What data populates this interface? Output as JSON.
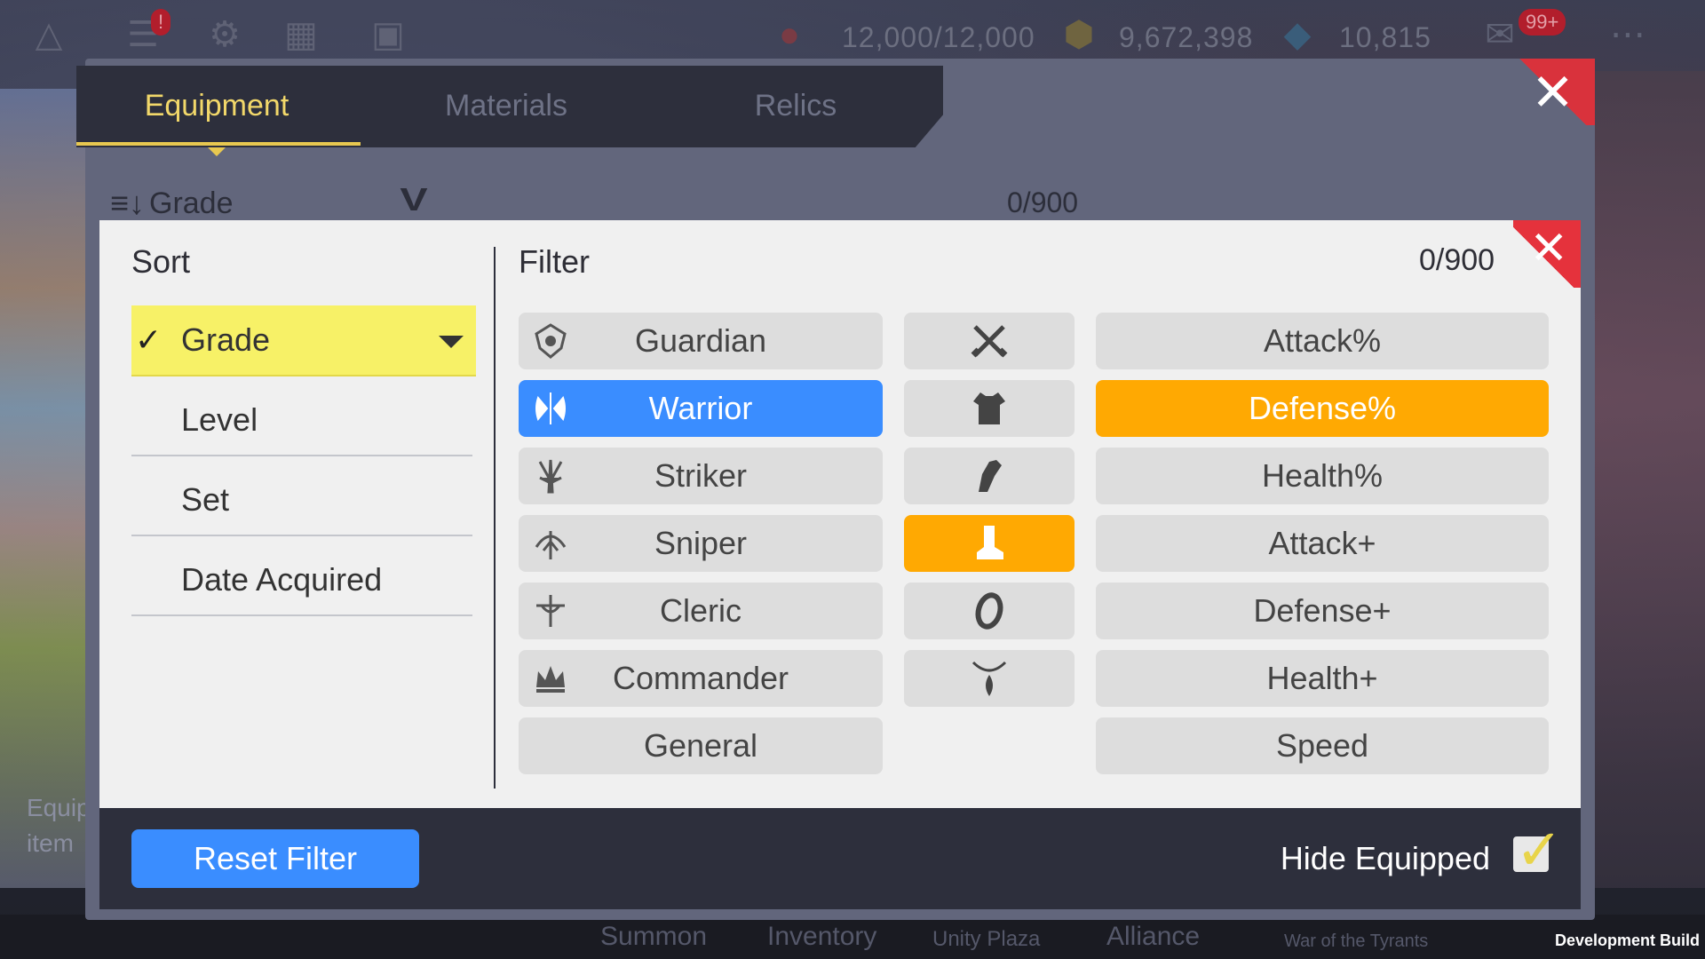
{
  "hud": {
    "stamina": "12,000/12,000",
    "gold": "9,672,398",
    "gems": "10,815",
    "mail_badge": "99+",
    "alert_badge": "!"
  },
  "panel": {
    "tabs": [
      {
        "label": "Equipment",
        "active": true
      },
      {
        "label": "Materials",
        "active": false
      },
      {
        "label": "Relics",
        "active": false
      }
    ],
    "sort_label": "Grade",
    "count": "0/900"
  },
  "modal": {
    "sort_title": "Sort",
    "filter_title": "Filter",
    "count": "0/900",
    "sort_options": [
      {
        "label": "Grade",
        "selected": true
      },
      {
        "label": "Level",
        "selected": false
      },
      {
        "label": "Set",
        "selected": false
      },
      {
        "label": "Date Acquired",
        "selected": false
      }
    ],
    "classes": [
      {
        "label": "Guardian",
        "icon": "guardian-icon",
        "selected": false
      },
      {
        "label": "Warrior",
        "icon": "warrior-icon",
        "selected": true
      },
      {
        "label": "Striker",
        "icon": "striker-icon",
        "selected": false
      },
      {
        "label": "Sniper",
        "icon": "sniper-icon",
        "selected": false
      },
      {
        "label": "Cleric",
        "icon": "cleric-icon",
        "selected": false
      },
      {
        "label": "Commander",
        "icon": "commander-icon",
        "selected": false
      },
      {
        "label": "General",
        "icon": "",
        "selected": false
      }
    ],
    "slots": [
      {
        "icon": "weapon-icon",
        "selected": false
      },
      {
        "icon": "armor-icon",
        "selected": false
      },
      {
        "icon": "gloves-icon",
        "selected": false
      },
      {
        "icon": "boots-icon",
        "selected": true
      },
      {
        "icon": "ring-icon",
        "selected": false
      },
      {
        "icon": "necklace-icon",
        "selected": false
      }
    ],
    "stats": [
      {
        "label": "Attack%",
        "selected": false
      },
      {
        "label": "Defense%",
        "selected": true
      },
      {
        "label": "Health%",
        "selected": false
      },
      {
        "label": "Attack+",
        "selected": false
      },
      {
        "label": "Defense+",
        "selected": false
      },
      {
        "label": "Health+",
        "selected": false
      },
      {
        "label": "Speed",
        "selected": false
      }
    ],
    "reset_label": "Reset Filter",
    "hide_equipped_label": "Hide Equipped",
    "hide_equipped_checked": true
  },
  "background": {
    "nav": [
      "Summon",
      "Inventory",
      "Unity Plaza",
      "Alliance",
      "War of the Tyrants"
    ],
    "side_text": "Equip item",
    "dev_build": "Development Build"
  },
  "colors": {
    "selected_blue": "#3a8dff",
    "selected_orange": "#ffa902",
    "selected_yellow": "#f7f167",
    "close_red": "#e5323c",
    "tab_active": "#f2d86a"
  }
}
